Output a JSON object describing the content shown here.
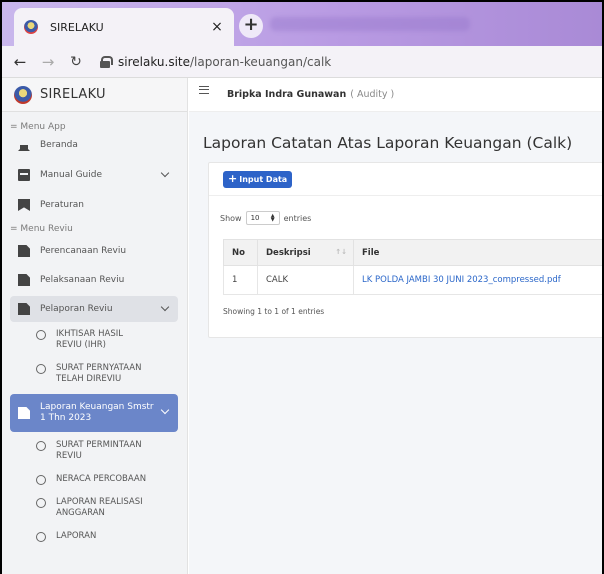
{
  "browser": {
    "tab_title": "SIRELAKU",
    "tab_close": "×",
    "new_tab": "+",
    "url_domain": "sirelaku.site",
    "url_path": "/laporan-keuangan/calk"
  },
  "sidebar": {
    "brand": "SIRELAKU",
    "sections": {
      "app": "= Menu App",
      "reviu": "= Menu Reviu"
    },
    "items": {
      "beranda": "Beranda",
      "manual": "Manual Guide",
      "peraturan": "Peraturan",
      "perencanaan": "Perencanaan Reviu",
      "pelaksanaan": "Pelaksanaan Reviu",
      "pelaporan": "Pelaporan Reviu",
      "ihr": "IKHTISAR HASIL REVIU (IHR)",
      "surat_pernyataan": "SURAT PERNYATAAN TELAH DIREVIU",
      "laporan_keuangan": "Laporan Keuangan Smstr 1 Thn 2023",
      "surat_permintaan": "SURAT PERMINTAAN REVIU",
      "neraca": "NERACA PERCOBAAN",
      "lra": "LAPORAN REALISASI ANGGARAN",
      "laporan": "LAPORAN"
    }
  },
  "topbar": {
    "user_name": "Bripka Indra Gunawan",
    "user_role": "( Audity )"
  },
  "main": {
    "title": "Laporan Catatan Atas Laporan Keuangan (Calk)",
    "input_button": "Input Data",
    "show_label": "Show",
    "entries_value": "10",
    "entries_label": "entries",
    "table": {
      "headers": [
        "No",
        "Deskripsi",
        "File"
      ],
      "rows": [
        [
          "1",
          "CALK",
          "LK POLDA JAMBI 30 JUNI 2023_compressed.pdf"
        ]
      ]
    },
    "info": "Showing 1 to 1 of 1 entries"
  }
}
